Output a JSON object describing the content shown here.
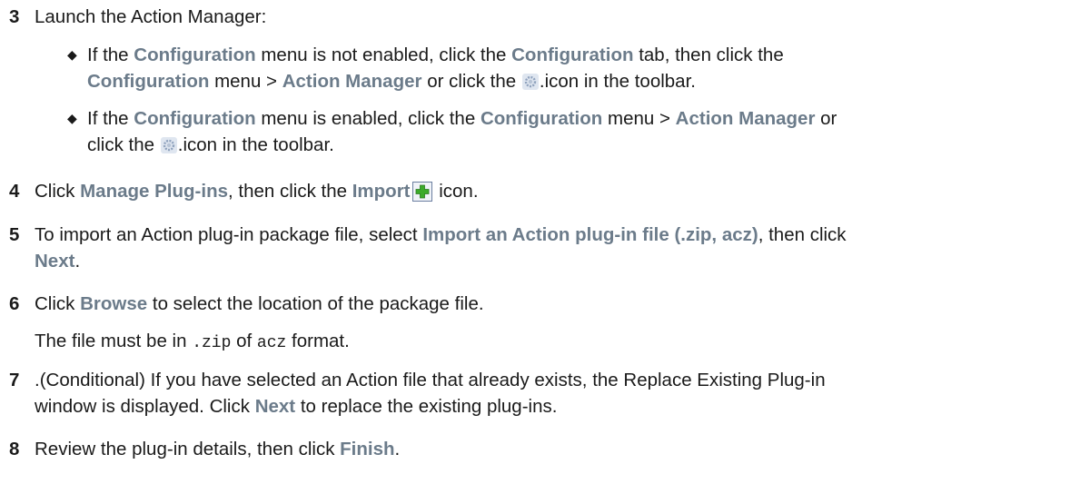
{
  "steps": {
    "s3": {
      "num": "3",
      "text": "Launch the Action Manager:",
      "b1": {
        "t1": "If the ",
        "u1": "Configuration",
        "t2": " menu is not enabled, click the ",
        "u2": "Configuration",
        "t3": " tab, then click the",
        "u3": "Configuration",
        "t4": " menu > ",
        "u4": "Action Manager",
        "t5": " or click the ",
        "t6": ".icon in the toolbar."
      },
      "b2": {
        "t1": "If the ",
        "u1": "Configuration",
        "t2": " menu is enabled, click the ",
        "u2": "Configuration",
        "t3": " menu > ",
        "u3": "Action Manager",
        "t4": " or",
        "t5": "click the ",
        "t6": ".icon in the toolbar."
      }
    },
    "s4": {
      "num": "4",
      "t1": "Click ",
      "u1": "Manage Plug-ins",
      "t2": ", then click the ",
      "u2": "Import",
      "t3": " icon."
    },
    "s5": {
      "num": "5",
      "t1": "To import an Action plug-in package file, select ",
      "u1": "Import an Action plug-in file (.zip, acz)",
      "t2": ", then click",
      "u2": "Next",
      "t3": "."
    },
    "s6": {
      "num": "6",
      "t1": "Click ",
      "u1": "Browse",
      "t2": " to select the location of the package file.",
      "n1": "The file must be in ",
      "m1": ".zip",
      "n2": " of ",
      "m2": "acz",
      "n3": " format."
    },
    "s7": {
      "num": "7",
      "line1": ".(Conditional) If you have selected an Action file that already exists, the Replace Existing Plug-in",
      "t1": "window is displayed. Click ",
      "u1": "Next",
      "t2": " to replace the existing plug-ins."
    },
    "s8": {
      "num": "8",
      "t1": "Review the plug-in details, then click ",
      "u1": "Finish",
      "t2": "."
    }
  },
  "icons": {
    "gear": "gear-icon",
    "import": "import-plus-icon"
  },
  "colors": {
    "ui_term": "#6b7b8a",
    "plus_green": "#3cab2b"
  }
}
